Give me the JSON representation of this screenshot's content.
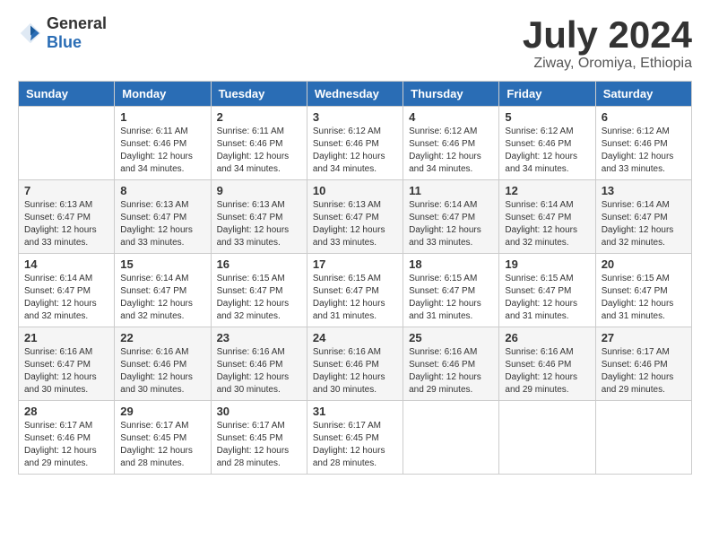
{
  "header": {
    "logo_general": "General",
    "logo_blue": "Blue",
    "month_title": "July 2024",
    "location": "Ziway, Oromiya, Ethiopia"
  },
  "weekdays": [
    "Sunday",
    "Monday",
    "Tuesday",
    "Wednesday",
    "Thursday",
    "Friday",
    "Saturday"
  ],
  "weeks": [
    [
      {
        "day": "",
        "info": ""
      },
      {
        "day": "1",
        "info": "Sunrise: 6:11 AM\nSunset: 6:46 PM\nDaylight: 12 hours\nand 34 minutes."
      },
      {
        "day": "2",
        "info": "Sunrise: 6:11 AM\nSunset: 6:46 PM\nDaylight: 12 hours\nand 34 minutes."
      },
      {
        "day": "3",
        "info": "Sunrise: 6:12 AM\nSunset: 6:46 PM\nDaylight: 12 hours\nand 34 minutes."
      },
      {
        "day": "4",
        "info": "Sunrise: 6:12 AM\nSunset: 6:46 PM\nDaylight: 12 hours\nand 34 minutes."
      },
      {
        "day": "5",
        "info": "Sunrise: 6:12 AM\nSunset: 6:46 PM\nDaylight: 12 hours\nand 34 minutes."
      },
      {
        "day": "6",
        "info": "Sunrise: 6:12 AM\nSunset: 6:46 PM\nDaylight: 12 hours\nand 33 minutes."
      }
    ],
    [
      {
        "day": "7",
        "info": "Sunrise: 6:13 AM\nSunset: 6:47 PM\nDaylight: 12 hours\nand 33 minutes."
      },
      {
        "day": "8",
        "info": "Sunrise: 6:13 AM\nSunset: 6:47 PM\nDaylight: 12 hours\nand 33 minutes."
      },
      {
        "day": "9",
        "info": "Sunrise: 6:13 AM\nSunset: 6:47 PM\nDaylight: 12 hours\nand 33 minutes."
      },
      {
        "day": "10",
        "info": "Sunrise: 6:13 AM\nSunset: 6:47 PM\nDaylight: 12 hours\nand 33 minutes."
      },
      {
        "day": "11",
        "info": "Sunrise: 6:14 AM\nSunset: 6:47 PM\nDaylight: 12 hours\nand 33 minutes."
      },
      {
        "day": "12",
        "info": "Sunrise: 6:14 AM\nSunset: 6:47 PM\nDaylight: 12 hours\nand 32 minutes."
      },
      {
        "day": "13",
        "info": "Sunrise: 6:14 AM\nSunset: 6:47 PM\nDaylight: 12 hours\nand 32 minutes."
      }
    ],
    [
      {
        "day": "14",
        "info": "Sunrise: 6:14 AM\nSunset: 6:47 PM\nDaylight: 12 hours\nand 32 minutes."
      },
      {
        "day": "15",
        "info": "Sunrise: 6:14 AM\nSunset: 6:47 PM\nDaylight: 12 hours\nand 32 minutes."
      },
      {
        "day": "16",
        "info": "Sunrise: 6:15 AM\nSunset: 6:47 PM\nDaylight: 12 hours\nand 32 minutes."
      },
      {
        "day": "17",
        "info": "Sunrise: 6:15 AM\nSunset: 6:47 PM\nDaylight: 12 hours\nand 31 minutes."
      },
      {
        "day": "18",
        "info": "Sunrise: 6:15 AM\nSunset: 6:47 PM\nDaylight: 12 hours\nand 31 minutes."
      },
      {
        "day": "19",
        "info": "Sunrise: 6:15 AM\nSunset: 6:47 PM\nDaylight: 12 hours\nand 31 minutes."
      },
      {
        "day": "20",
        "info": "Sunrise: 6:15 AM\nSunset: 6:47 PM\nDaylight: 12 hours\nand 31 minutes."
      }
    ],
    [
      {
        "day": "21",
        "info": "Sunrise: 6:16 AM\nSunset: 6:47 PM\nDaylight: 12 hours\nand 30 minutes."
      },
      {
        "day": "22",
        "info": "Sunrise: 6:16 AM\nSunset: 6:46 PM\nDaylight: 12 hours\nand 30 minutes."
      },
      {
        "day": "23",
        "info": "Sunrise: 6:16 AM\nSunset: 6:46 PM\nDaylight: 12 hours\nand 30 minutes."
      },
      {
        "day": "24",
        "info": "Sunrise: 6:16 AM\nSunset: 6:46 PM\nDaylight: 12 hours\nand 30 minutes."
      },
      {
        "day": "25",
        "info": "Sunrise: 6:16 AM\nSunset: 6:46 PM\nDaylight: 12 hours\nand 29 minutes."
      },
      {
        "day": "26",
        "info": "Sunrise: 6:16 AM\nSunset: 6:46 PM\nDaylight: 12 hours\nand 29 minutes."
      },
      {
        "day": "27",
        "info": "Sunrise: 6:17 AM\nSunset: 6:46 PM\nDaylight: 12 hours\nand 29 minutes."
      }
    ],
    [
      {
        "day": "28",
        "info": "Sunrise: 6:17 AM\nSunset: 6:46 PM\nDaylight: 12 hours\nand 29 minutes."
      },
      {
        "day": "29",
        "info": "Sunrise: 6:17 AM\nSunset: 6:45 PM\nDaylight: 12 hours\nand 28 minutes."
      },
      {
        "day": "30",
        "info": "Sunrise: 6:17 AM\nSunset: 6:45 PM\nDaylight: 12 hours\nand 28 minutes."
      },
      {
        "day": "31",
        "info": "Sunrise: 6:17 AM\nSunset: 6:45 PM\nDaylight: 12 hours\nand 28 minutes."
      },
      {
        "day": "",
        "info": ""
      },
      {
        "day": "",
        "info": ""
      },
      {
        "day": "",
        "info": ""
      }
    ]
  ]
}
